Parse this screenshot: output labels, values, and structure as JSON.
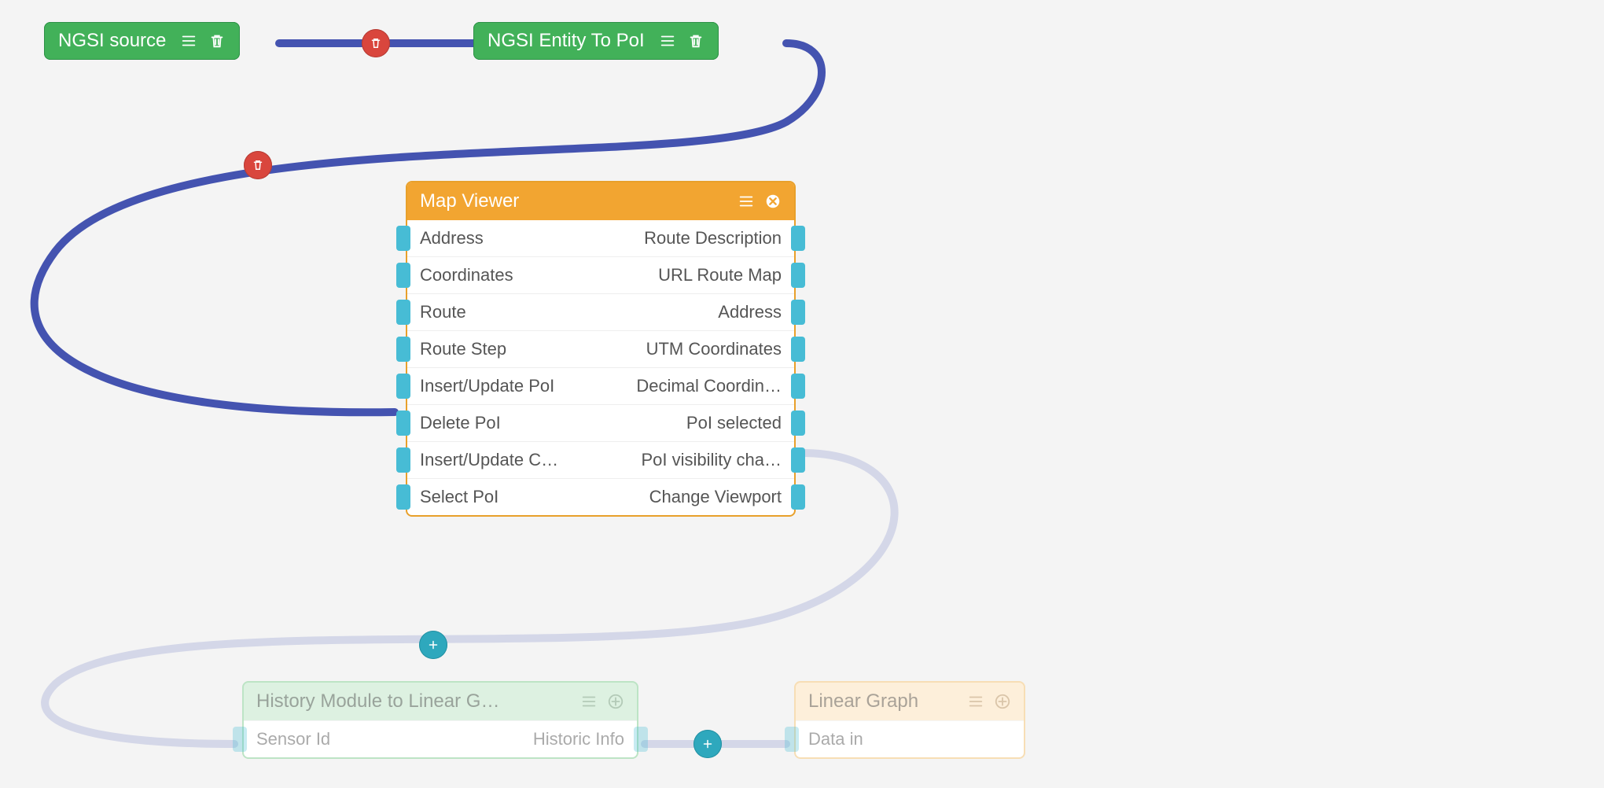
{
  "nodes": {
    "ngsi_source": {
      "title": "NGSI source"
    },
    "ngsi_to_poi": {
      "title": "NGSI Entity To PoI"
    },
    "map_viewer": {
      "title": "Map Viewer",
      "rows": [
        {
          "left": "Address",
          "right": "Route Description"
        },
        {
          "left": "Coordinates",
          "right": "URL Route Map"
        },
        {
          "left": "Route",
          "right": "Address"
        },
        {
          "left": "Route Step",
          "right": "UTM Coordinates"
        },
        {
          "left": "Insert/Update PoI",
          "right": "Decimal Coordin…"
        },
        {
          "left": "Delete PoI",
          "right": "PoI selected"
        },
        {
          "left": "Insert/Update C…",
          "right": "PoI visibility cha…"
        },
        {
          "left": "Select PoI",
          "right": "Change Viewport"
        }
      ]
    },
    "history_module": {
      "title": "History Module to Linear G…",
      "row": {
        "left": "Sensor Id",
        "right": "Historic Info"
      }
    },
    "linear_graph": {
      "title": "Linear Graph",
      "row": {
        "left": "Data in",
        "right": ""
      }
    }
  }
}
